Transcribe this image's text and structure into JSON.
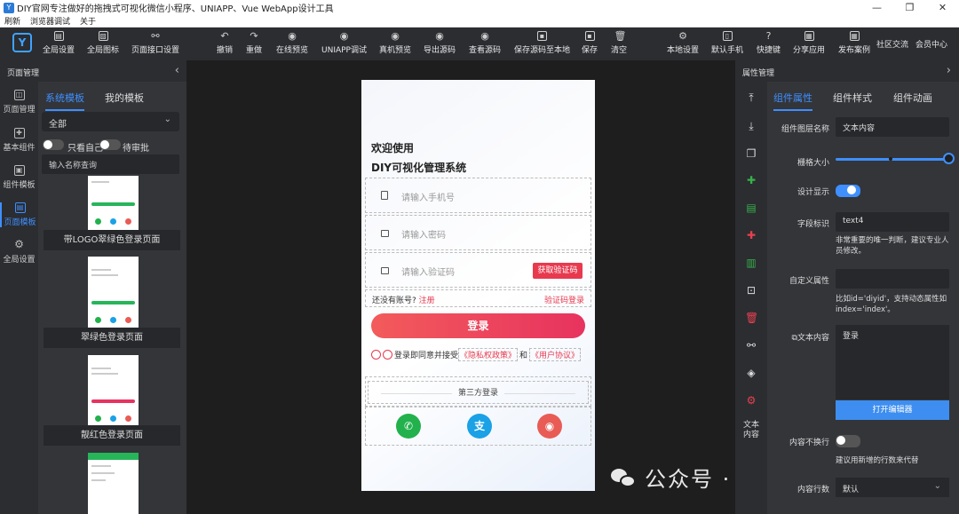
{
  "window": {
    "title": "DIY官网专注做好的拖拽式可视化微信小程序、UNIAPP、Vue WebApp设计工具",
    "minimize": "—",
    "maximize": "❐",
    "close": "✕"
  },
  "menubar": [
    "刷新",
    "浏览器调试",
    "关于"
  ],
  "toolbar": {
    "logo": "Y",
    "left": [
      "全局设置",
      "全局图标",
      "页面接口设置"
    ],
    "center": [
      "撤销",
      "重做",
      "在线预览",
      "UNIAPP调试",
      "真机预览",
      "导出源码",
      "查看源码",
      "保存源码至本地",
      "保存",
      "清空"
    ],
    "right": [
      "本地设置",
      "默认手机",
      "快捷键",
      "分享应用",
      "发布案例",
      "社区交流",
      "会员中心"
    ]
  },
  "left_panel": {
    "header": "页面管理",
    "chevron": "‹",
    "rail": [
      "页面管理",
      "基本组件",
      "组件模板",
      "页面模板",
      "全局设置"
    ],
    "tabs": [
      "系统模板",
      "我的模板"
    ],
    "filter_select": "全部",
    "toggle_mine": "只看自己",
    "toggle_review": "待审批",
    "search_placeholder": "输入名称查询",
    "templates": [
      "带LOGO翠绿色登录页面",
      "翠绿色登录页面",
      "靓红色登录页面"
    ]
  },
  "phone": {
    "title1": "欢迎使用",
    "title2": "DIY可视化管理系统",
    "phone_placeholder": "请输入手机号",
    "password_placeholder": "请输入密码",
    "code_placeholder": "请输入验证码",
    "get_code": "获取验证码",
    "no_account": "还没有账号?",
    "register": "注册",
    "code_login": "验证码登录",
    "login": "登录",
    "agree_prefix": "登录即同意并接受",
    "privacy": "《隐私权政策》",
    "and": "和",
    "user_agreement": "《用户协议》",
    "third_party": "第三方登录",
    "social": [
      {
        "name": "wechat",
        "glyph": "✆",
        "color": "#22b14c"
      },
      {
        "name": "alipay",
        "glyph": "支",
        "color": "#1aa1e6"
      },
      {
        "name": "weibo",
        "glyph": "◉",
        "color": "#e85c55"
      }
    ]
  },
  "watermark": "公众号 · 前端组件开发",
  "right_panel": {
    "header": "属性管理",
    "chevron": "›",
    "rail_text": "文本内容",
    "tabs": [
      "组件属性",
      "组件样式",
      "组件动画"
    ],
    "layer_name_label": "组件图层名称",
    "layer_name_value": "文本内容",
    "grid_size_label": "栅格大小",
    "grid_size_value": 1,
    "design_display_label": "设计显示",
    "field_id_label": "字段标识",
    "field_id_value": "text4",
    "field_id_hint": "非常重要的唯一判断，建议专业人员修改。",
    "custom_attr_label": "自定义属性",
    "custom_attr_hint": "比如id='diyid'，支持动态属性如index='index'。",
    "text_content_label": "文本内容",
    "text_content_value": "登录",
    "open_editor": "打开编辑器",
    "nowrap_label": "内容不换行",
    "nowrap_hint": "建议用新增的行数来代替",
    "lines_label": "内容行数",
    "lines_value": "默认"
  }
}
